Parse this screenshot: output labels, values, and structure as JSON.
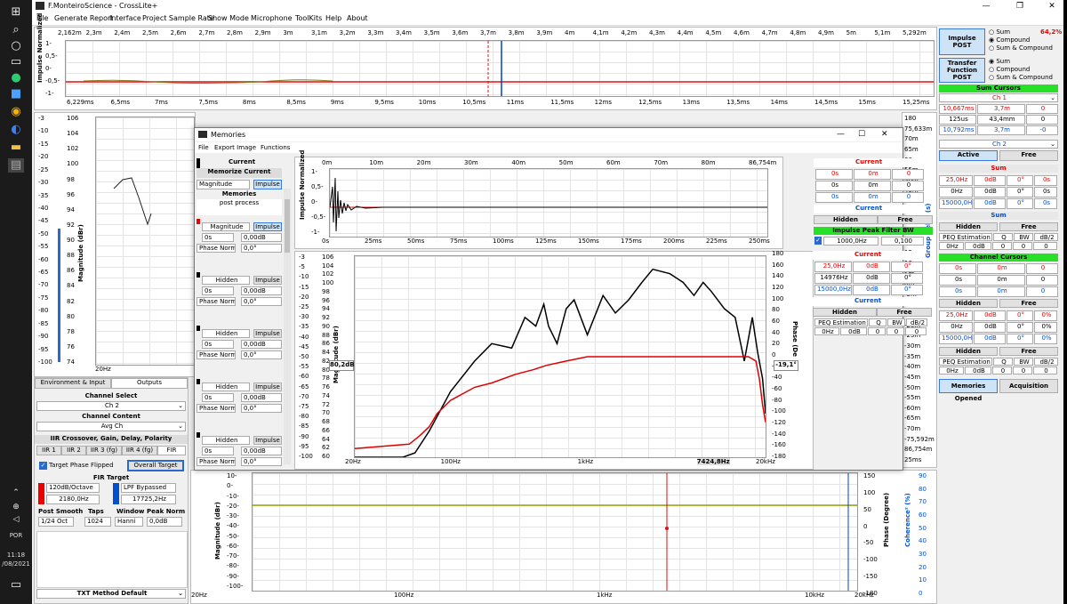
{
  "taskbar": {
    "lang": "POR",
    "time": "11:18",
    "date": "/08/2021"
  },
  "window": {
    "title": "F.MonteiroScience - CrossLite+",
    "minimize": "—",
    "maximize": "❐",
    "close": "✕"
  },
  "menu": [
    "File",
    "Generate Report",
    "Interface",
    "Project Sample Rate",
    "Show Mode",
    "Microphone",
    "ToolKits",
    "Help",
    "About"
  ],
  "impulse_top": {
    "top_ticks": [
      "2,162m",
      "2,3m",
      "2,4m",
      "2,5m",
      "2,6m",
      "2,7m",
      "2,8m",
      "2,9m",
      "3m",
      "3,1m",
      "3,2m",
      "3,3m",
      "3,4m",
      "3,5m",
      "3,6m",
      "3,7m",
      "3,8m",
      "3,9m",
      "4m",
      "4,1m",
      "4,2m",
      "4,3m",
      "4,4m",
      "4,5m",
      "4,6m",
      "4,7m",
      "4,8m",
      "4,9m",
      "5m",
      "5,1m",
      "5,292m"
    ],
    "bottom_ticks": [
      "6,229ms",
      "6,5ms",
      "7ms",
      "7,5ms",
      "8ms",
      "8,5ms",
      "9ms",
      "9,5ms",
      "10ms",
      "10,5ms",
      "11ms",
      "11,5ms",
      "12ms",
      "12,5ms",
      "13ms",
      "13,5ms",
      "14ms",
      "14,5ms",
      "15ms",
      "15,25ms"
    ],
    "y_ticks": [
      "1-",
      "0,5-",
      "0-",
      "-0,5-",
      "-1-"
    ],
    "ylabel": "Impulse Normalized"
  },
  "left_chart": {
    "y1_ticks": [
      "-3",
      "-10",
      "-15",
      "-20",
      "-25",
      "-30",
      "-35",
      "-40",
      "-45",
      "-50",
      "-55",
      "-60",
      "-65",
      "-70",
      "-75",
      "-80",
      "-85",
      "-90",
      "-95",
      "-100"
    ],
    "y2_ticks": [
      "106",
      "104",
      "102",
      "100",
      "98",
      "96",
      "94",
      "92",
      "90",
      "88",
      "86",
      "84",
      "82",
      "80",
      "78",
      "76",
      "74"
    ],
    "ylabel": "Magnitude (dBr)",
    "xstart": "20Hz"
  },
  "outputs_panel": {
    "tabs": [
      "Environment & Input",
      "Outputs"
    ],
    "channel_select_label": "Channel Select",
    "channel_select_value": "Ch 2",
    "channel_content_label": "Channel Content",
    "channel_content_value": "Avg Ch",
    "iir_header": "IIR Crossover, Gain, Delay, Polarity",
    "iir_tabs": [
      "IIR 1",
      "IIR 2",
      "IIR 3 (fg)",
      "IIR 4 (fg)",
      "FIR"
    ],
    "target_phase": "Target Phase Flipped",
    "overall_target": "Overall Target",
    "fir_target": "FIR Target",
    "hpf_order": "120dB/Octave",
    "hpf_freq": "2180,0Hz",
    "lpf": "LPF Bypassed",
    "lpf_freq": "17725,2Hz",
    "labels": [
      "Post Smooth",
      "Taps",
      "Window",
      "Peak Norm"
    ],
    "values": [
      "1/24 Oct",
      "1024",
      "Hanni",
      "0,0dB"
    ],
    "txt_method": "TXT Method Default"
  },
  "bottom_chart": {
    "x_ticks": [
      "20Hz",
      "100Hz",
      "1kHz",
      "10kHz",
      "20kHz"
    ],
    "y_ticks": [
      "10-",
      "0-",
      "-10-",
      "-20-",
      "-30-",
      "-40-",
      "-50-",
      "-60-",
      "-70-",
      "-80-",
      "-90-",
      "-100-"
    ],
    "phase_ticks": [
      "150",
      "100",
      "50",
      "0",
      "-50",
      "-100",
      "-150",
      "-180"
    ],
    "ylabel": "Magnitude (dBr)",
    "phase_label": "Phase (Degree)",
    "coherence_label": "Coherence² (%)",
    "coh_ticks": [
      "90",
      "80",
      "70",
      "60",
      "50",
      "40",
      "30",
      "20",
      "10",
      "0"
    ]
  },
  "right_strip": {
    "group_delay_label": "Group Delay (s)",
    "ticks": [
      "180",
      "75,633m",
      "70m",
      "65m",
      "60m",
      "55m",
      "50m",
      "45m",
      "40m",
      "35m",
      "30m",
      "25m",
      "20m",
      "15m",
      "10m",
      "5m",
      "0m",
      "-5m",
      "-10m",
      "-15m",
      "-20m",
      "-25m",
      "-30m",
      "-35m",
      "-40m",
      "-45m",
      "-50m",
      "-55m",
      "-60m",
      "-65m",
      "-70m",
      "-75,592m",
      "86,754m",
      "25ms"
    ]
  },
  "right_panel": {
    "impulse_post": "Impulse POST",
    "tf_post": "Transfer Function POST",
    "radio1": [
      "Sum",
      "Compound",
      "Sum & Compound"
    ],
    "radio1_pct": "64,2%",
    "radio2": [
      "Sum",
      "Compound",
      "Sum & Compound"
    ],
    "sum_cursors": "Sum Cursors",
    "ch1": "Ch 1",
    "cur_rows": [
      [
        "10,667ms",
        "3,7m",
        "0"
      ],
      [
        "125us",
        "43,4mm",
        "0"
      ],
      [
        "10,792ms",
        "3,7m",
        "-0"
      ]
    ],
    "ch2": "Ch 2",
    "active": "Active",
    "free": "Free",
    "sum": "Sum",
    "sum_rows": [
      [
        "25,0Hz",
        "0dB",
        "0°",
        "0s"
      ],
      [
        "0Hz",
        "0dB",
        "0°",
        "0s"
      ],
      [
        "15000,0Hz",
        "0dB",
        "0°",
        "0s"
      ]
    ],
    "sum2": "Sum",
    "hidden": "Hidden",
    "free2": "Free",
    "peq_headers": [
      "PEQ Estimation",
      "Q",
      "BW",
      "dB/2"
    ],
    "peq_row": [
      "0Hz",
      "0dB",
      "0",
      "0",
      "0"
    ],
    "channel_cursors": "Channel Cursors",
    "ch_rows": [
      [
        "0s",
        "0m",
        "0"
      ],
      [
        "0s",
        "0m",
        "0"
      ],
      [
        "0s",
        "0m",
        "0"
      ]
    ],
    "hidden2": "Hidden",
    "free3": "Free",
    "ch_rows2": [
      [
        "25,0Hz",
        "0dB",
        "0°",
        "0%"
      ],
      [
        "0Hz",
        "0dB",
        "0°",
        "0%"
      ],
      [
        "15000,0Hz",
        "0dB",
        "0°",
        "0%"
      ]
    ],
    "hidden3": "Hidden",
    "free4": "Free",
    "peq_headers2": [
      "PEQ Estimation",
      "Q",
      "BW",
      "dB/2"
    ],
    "peq_row2": [
      "0Hz",
      "0dB",
      "0",
      "0",
      "0"
    ],
    "memories_opened": "Memories Opened",
    "acquisition": "Acquisition"
  },
  "memories": {
    "title": "Memories",
    "menu": [
      "File",
      "Export Image",
      "Functions"
    ],
    "current": "Current",
    "memorize_current": "Memorize Current",
    "magnitude": "Magnitude",
    "impulse": "Impulse",
    "memories_label": "Memories",
    "post_process": "post process",
    "slots": [
      {
        "mode": "Magnitude",
        "val1": "0s",
        "val2": "0,00dB",
        "phase": "Phase Normal",
        "deg": "0,0°"
      },
      {
        "mode": "Hidden",
        "val1": "0s",
        "val2": "0,00dB",
        "phase": "Phase Normal",
        "deg": "0,0°"
      },
      {
        "mode": "Hidden",
        "val1": "0s",
        "val2": "0,00dB",
        "phase": "Phase Normal",
        "deg": "0,0°"
      },
      {
        "mode": "Hidden",
        "val1": "0s",
        "val2": "0,00dB",
        "phase": "Phase Normal",
        "deg": "0,0°"
      },
      {
        "mode": "Hidden",
        "val1": "0s",
        "val2": "0,00dB",
        "phase": "Phase Normal",
        "deg": "0,0°"
      }
    ],
    "imp_top_ticks": [
      "0m",
      "10m",
      "20m",
      "30m",
      "40m",
      "50m",
      "60m",
      "70m",
      "80m",
      "86,754m"
    ],
    "imp_bottom_ticks": [
      "0s",
      "25ms",
      "50ms",
      "75ms",
      "100ms",
      "125ms",
      "150ms",
      "175ms",
      "200ms",
      "225ms",
      "250ms"
    ],
    "imp_y": [
      "1-",
      "0,5-",
      "0-",
      "-0,5-",
      "-1-"
    ],
    "imp_ylabel": "Impulse Normalized",
    "mag_y1": [
      "-3",
      "-5",
      "-10",
      "-15",
      "-20",
      "-25",
      "-30",
      "-35",
      "-40",
      "-45",
      "-50",
      "-55",
      "-60",
      "-65",
      "-70",
      "-75",
      "-80",
      "-85",
      "-90",
      "-95",
      "-100"
    ],
    "mag_y2": [
      "106",
      "104",
      "102",
      "100",
      "98",
      "96",
      "94",
      "92",
      "90",
      "88",
      "86",
      "84",
      "82",
      "80",
      "78",
      "76",
      "74",
      "72",
      "70",
      "68",
      "66",
      "64",
      "62",
      "60"
    ],
    "mag_y3": [
      "180",
      "160",
      "140",
      "120",
      "100",
      "80",
      "60",
      "40",
      "20",
      "0",
      "-20",
      "-40",
      "-60",
      "-80",
      "-100",
      "-120",
      "-140",
      "-160",
      "-180"
    ],
    "mag_x": [
      "20Hz",
      "100Hz",
      "1kHz",
      "7424,8Hz",
      "20kHz"
    ],
    "cursor_val": "80,2dB",
    "phase_val": "-19,1°",
    "phase_label": "Phase (De",
    "mag_ylabel": "Magnitude (dBr)",
    "rp_current": "Current",
    "rp_rows": [
      [
        "0s",
        "0m",
        "0"
      ],
      [
        "0s",
        "0m",
        "0"
      ],
      [
        "0s",
        "0m",
        "0"
      ]
    ],
    "rp_current2": "Current",
    "rp_hidden": "Hidden",
    "rp_free": "Free",
    "ipf": "Impulse Peak Filter BW",
    "ipf_freq": "1000,0Hz",
    "ipf_bw": "0,100",
    "rp_current3": "Current",
    "rp_rows2": [
      [
        "25,0Hz",
        "0dB",
        "0°"
      ],
      [
        "14976Hz",
        "0dB",
        "0°"
      ],
      [
        "15000,0Hz",
        "0dB",
        "0°"
      ]
    ],
    "rp_current4": "Current",
    "rp_hidden2": "Hidden",
    "rp_free2": "Free",
    "rp_peq": [
      "PEQ Estimation",
      "Q",
      "BW",
      "dB/2"
    ],
    "rp_peq_row": [
      "0Hz",
      "0dB",
      "0",
      "0",
      "0"
    ]
  },
  "chart_data": [
    {
      "type": "line",
      "xlabel": "",
      "ylabel": "Magnitude (dBr)",
      "x_scale": "log",
      "xlim": [
        20,
        20000
      ],
      "ylim": [
        60,
        106
      ],
      "x_ticks": [
        "20Hz",
        "100Hz",
        "1kHz",
        "7424,8Hz",
        "20kHz"
      ],
      "series": [
        {
          "color": "#000000",
          "x": [
            20,
            32,
            45,
            55,
            70,
            100,
            150,
            200,
            280,
            350,
            420,
            480,
            520,
            600,
            700,
            800,
            1000,
            1300,
            1600,
            2000,
            2500,
            3000,
            4000,
            5000,
            6000,
            7000,
            8000,
            10000,
            12000,
            14000,
            16000,
            17500,
            19000,
            20000
          ],
          "y": [
            60,
            60,
            60,
            61,
            66,
            75,
            82,
            86,
            85,
            92,
            90,
            95,
            90,
            86,
            94,
            96,
            88,
            97,
            93,
            96,
            100,
            103,
            102,
            100,
            97,
            100,
            98,
            94,
            92,
            82,
            92,
            84,
            78,
            70
          ]
        },
        {
          "color": "#e00000",
          "x": [
            20,
            50,
            60,
            70,
            80,
            100,
            150,
            200,
            300,
            400,
            500,
            700,
            1000,
            1500,
            2000,
            3000,
            5000,
            8000,
            10000,
            15000,
            17000,
            18000,
            19000,
            20000
          ],
          "y": [
            62,
            63,
            65,
            67,
            70,
            73,
            76,
            77,
            79,
            80,
            81,
            82,
            83,
            83,
            83,
            83,
            83,
            83,
            83,
            83,
            82,
            78,
            72,
            68
          ]
        }
      ]
    }
  ]
}
